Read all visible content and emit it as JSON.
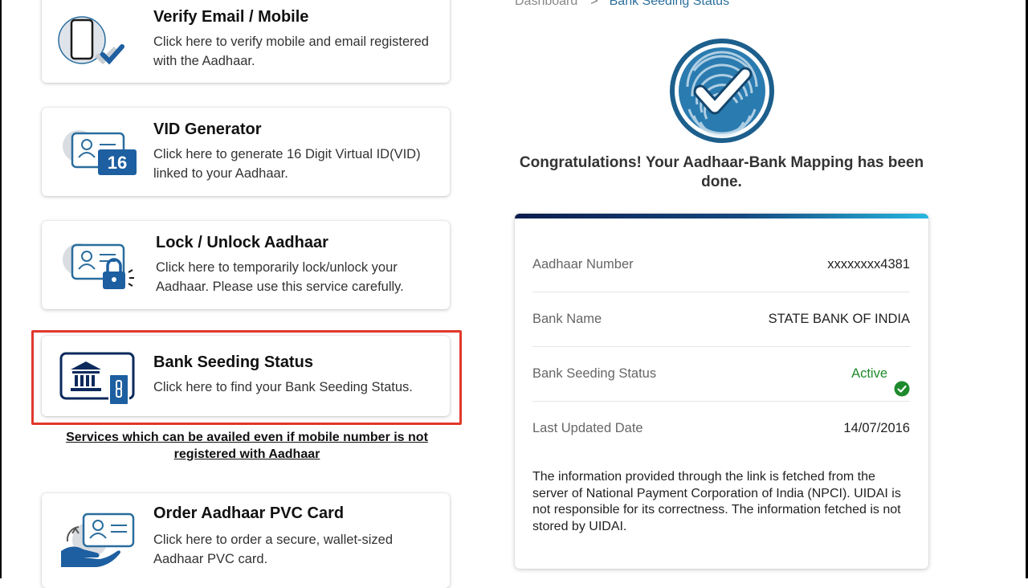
{
  "cards": [
    {
      "title": "Verify Email / Mobile",
      "desc": "Click here to verify mobile and email registered with the Aadhaar.",
      "icon": "phone-verify-icon"
    },
    {
      "title": "VID Generator",
      "desc": "Click here to generate 16 Digit Virtual ID(VID) linked to your Aadhaar.",
      "icon": "vid-card-icon",
      "badge": "16"
    },
    {
      "title": "Lock / Unlock Aadhaar",
      "desc": "Click here to temporarily lock/unlock your Aadhaar. Please use this service carefully.",
      "icon": "lock-card-icon"
    },
    {
      "title": "Bank Seeding Status",
      "desc": "Click here to find your Bank Seeding Status.",
      "icon": "bank-icon"
    },
    {
      "title": "Order Aadhaar PVC Card",
      "desc": "Click here to order a secure, wallet-sized Aadhaar PVC card.",
      "icon": "pvc-card-hand-icon"
    }
  ],
  "note": "Services which can be availed even if mobile number is not registered with Aadhaar",
  "breadcrumb": {
    "parent": "Dashboard",
    "separator": ">",
    "current": "Bank Seeding Status"
  },
  "congrats": "Congratulations! Your Aadhaar-Bank Mapping has been done.",
  "details": [
    {
      "label": "Aadhaar Number",
      "value": "xxxxxxxx4381"
    },
    {
      "label": "Bank Name",
      "value": "STATE BANK OF INDIA"
    },
    {
      "label": "Bank Seeding Status",
      "value": "Active"
    },
    {
      "label": "Last Updated Date",
      "value": "14/07/2016"
    }
  ],
  "info": "The information provided through the link is fetched from the server of National Payment Corporation of India (NPCI). UIDAI is not responsible for its correctness. The information fetched is not stored by UIDAI.",
  "colors": {
    "accent": "#2b6f9c",
    "active": "#1e8a2c",
    "highlight": "#e0382b",
    "navy": "#0d2a5c"
  }
}
